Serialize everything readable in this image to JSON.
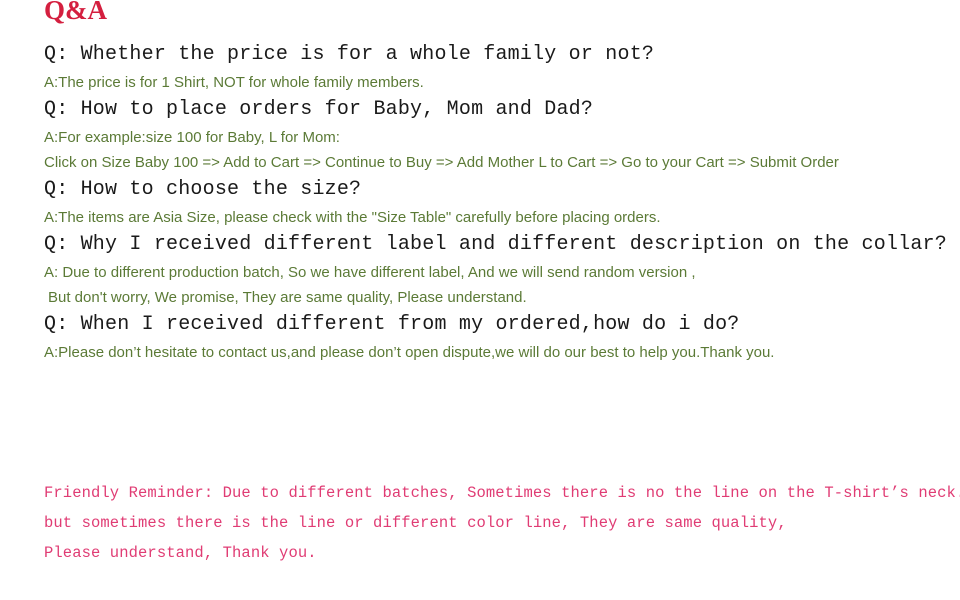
{
  "heading": {
    "title": "Q&A",
    "color": "#d41f3f"
  },
  "colors": {
    "question_text": "#1a1a1a",
    "answer_text": "#5b7a36",
    "reminder_text": "#e03c74",
    "background": "#ffffff"
  },
  "qa": [
    {
      "question": "Q: Whether the price is for a whole family or not?",
      "answers": [
        "A:The price is for 1 Shirt, NOT for whole family members."
      ]
    },
    {
      "question": "Q: How to place orders for Baby, Mom and Dad?",
      "answers": [
        "A:For example:size 100 for Baby, L for Mom:",
        "Click on Size Baby 100 => Add to Cart => Continue to Buy => Add Mother L to Cart => Go to your Cart => Submit Order"
      ]
    },
    {
      "question": "Q: How to choose the size?",
      "answers": [
        "A:The items are Asia Size, please check with the \"Size Table\" carefully before placing orders."
      ]
    },
    {
      "question": "Q: Why I received different label and different description on the collar?",
      "answers": [
        "A: Due to different production batch, So we have different label, And we will send random version ,",
        " But don't worry, We promise, They are same quality, Please understand."
      ]
    },
    {
      "question": "Q: When I received different from my ordered,how do i do?",
      "answers": [
        "A:Please don’t hesitate to contact us,and please don’t open dispute,we will do our best to help you.Thank you."
      ]
    }
  ],
  "reminder": {
    "lines": [
      "Friendly Reminder: Due to different batches, Sometimes there is no the line on the T-shirt’s neck.",
      "but sometimes there is the line or different color line, They are same quality,",
      "Please understand, Thank you."
    ]
  }
}
